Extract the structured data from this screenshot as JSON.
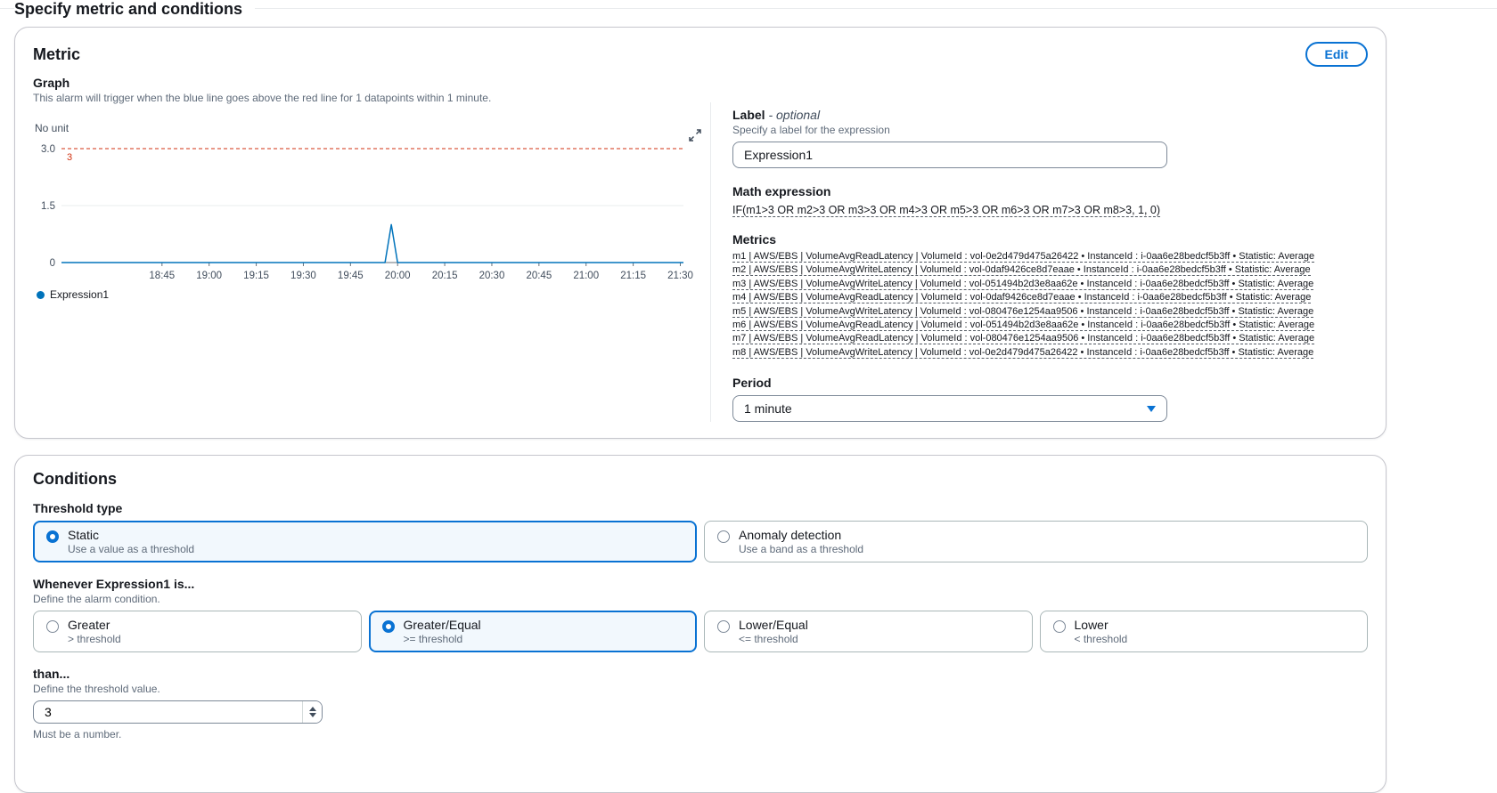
{
  "page": {
    "title": "Specify metric and conditions"
  },
  "metric_card": {
    "title": "Metric",
    "edit_button": "Edit",
    "graph": {
      "label": "Graph",
      "description": "This alarm will trigger when the blue line goes above the red line for 1 datapoints within 1 minute.",
      "unit_label": "No unit"
    },
    "label_field": {
      "label": "Label",
      "optional_suffix": "- optional",
      "hint": "Specify a label for the expression",
      "value": "Expression1"
    },
    "math_expression": {
      "label": "Math expression",
      "value": "IF(m1>3 OR m2>3 OR m3>3 OR m4>3 OR m5>3 OR m6>3 OR m7>3 OR m8>3, 1, 0)"
    },
    "metrics": {
      "label": "Metrics",
      "items": [
        "m1 | AWS/EBS | VolumeAvgReadLatency | VolumeId : vol-0e2d479d475a26422 • InstanceId : i-0aa6e28bedcf5b3ff • Statistic: Average",
        "m2 | AWS/EBS | VolumeAvgWriteLatency | VolumeId : vol-0daf9426ce8d7eaae • InstanceId : i-0aa6e28bedcf5b3ff • Statistic: Average",
        "m3 | AWS/EBS | VolumeAvgWriteLatency | VolumeId : vol-051494b2d3e8aa62e • InstanceId : i-0aa6e28bedcf5b3ff • Statistic: Average",
        "m4 | AWS/EBS | VolumeAvgReadLatency | VolumeId : vol-0daf9426ce8d7eaae • InstanceId : i-0aa6e28bedcf5b3ff • Statistic: Average",
        "m5 | AWS/EBS | VolumeAvgWriteLatency | VolumeId : vol-080476e1254aa9506 • InstanceId : i-0aa6e28bedcf5b3ff • Statistic: Average",
        "m6 | AWS/EBS | VolumeAvgReadLatency | VolumeId : vol-051494b2d3e8aa62e • InstanceId : i-0aa6e28bedcf5b3ff • Statistic: Average",
        "m7 | AWS/EBS | VolumeAvgReadLatency | VolumeId : vol-080476e1254aa9506 • InstanceId : i-0aa6e28bedcf5b3ff • Statistic: Average",
        "m8 | AWS/EBS | VolumeAvgWriteLatency | VolumeId : vol-0e2d479d475a26422 • InstanceId : i-0aa6e28bedcf5b3ff • Statistic: Average"
      ]
    },
    "period": {
      "label": "Period",
      "value": "1 minute"
    }
  },
  "chart_data": {
    "type": "line",
    "unit_label": "No unit",
    "y_ticks": [
      {
        "value": 3,
        "label": "3.0"
      },
      {
        "value": 1.5,
        "label": "1.5"
      },
      {
        "value": 0,
        "label": "0"
      }
    ],
    "ylim": [
      0,
      3.2
    ],
    "x_ticks": [
      "18:45",
      "19:00",
      "19:15",
      "19:30",
      "19:45",
      "20:00",
      "20:15",
      "20:30",
      "20:45",
      "21:00",
      "21:15",
      "21:30"
    ],
    "x_window": {
      "start": "18:13",
      "end": "21:31"
    },
    "threshold_line": {
      "value": 3,
      "label": "3",
      "color": "#d13212",
      "style": "dashed"
    },
    "series": [
      {
        "name": "Expression1",
        "color": "#0073bb",
        "points": [
          {
            "t": "18:13",
            "v": 0
          },
          {
            "t": "19:56",
            "v": 0
          },
          {
            "t": "19:58",
            "v": 1
          },
          {
            "t": "20:00",
            "v": 0
          },
          {
            "t": "21:31",
            "v": 0
          }
        ]
      }
    ],
    "legend_position": "bottom-left"
  },
  "conditions_card": {
    "title": "Conditions",
    "threshold_type": {
      "label": "Threshold type",
      "options": [
        {
          "label": "Static",
          "description": "Use a value as a threshold",
          "selected": true
        },
        {
          "label": "Anomaly detection",
          "description": "Use a band as a threshold",
          "selected": false
        }
      ]
    },
    "alarm_condition": {
      "label": "Whenever Expression1 is...",
      "hint": "Define the alarm condition.",
      "options": [
        {
          "label": "Greater",
          "description": "> threshold",
          "selected": false
        },
        {
          "label": "Greater/Equal",
          "description": ">= threshold",
          "selected": true
        },
        {
          "label": "Lower/Equal",
          "description": "<= threshold",
          "selected": false
        },
        {
          "label": "Lower",
          "description": "< threshold",
          "selected": false
        }
      ]
    },
    "threshold_value": {
      "label": "than...",
      "hint": "Define the threshold value.",
      "value": "3",
      "validation": "Must be a number."
    }
  }
}
